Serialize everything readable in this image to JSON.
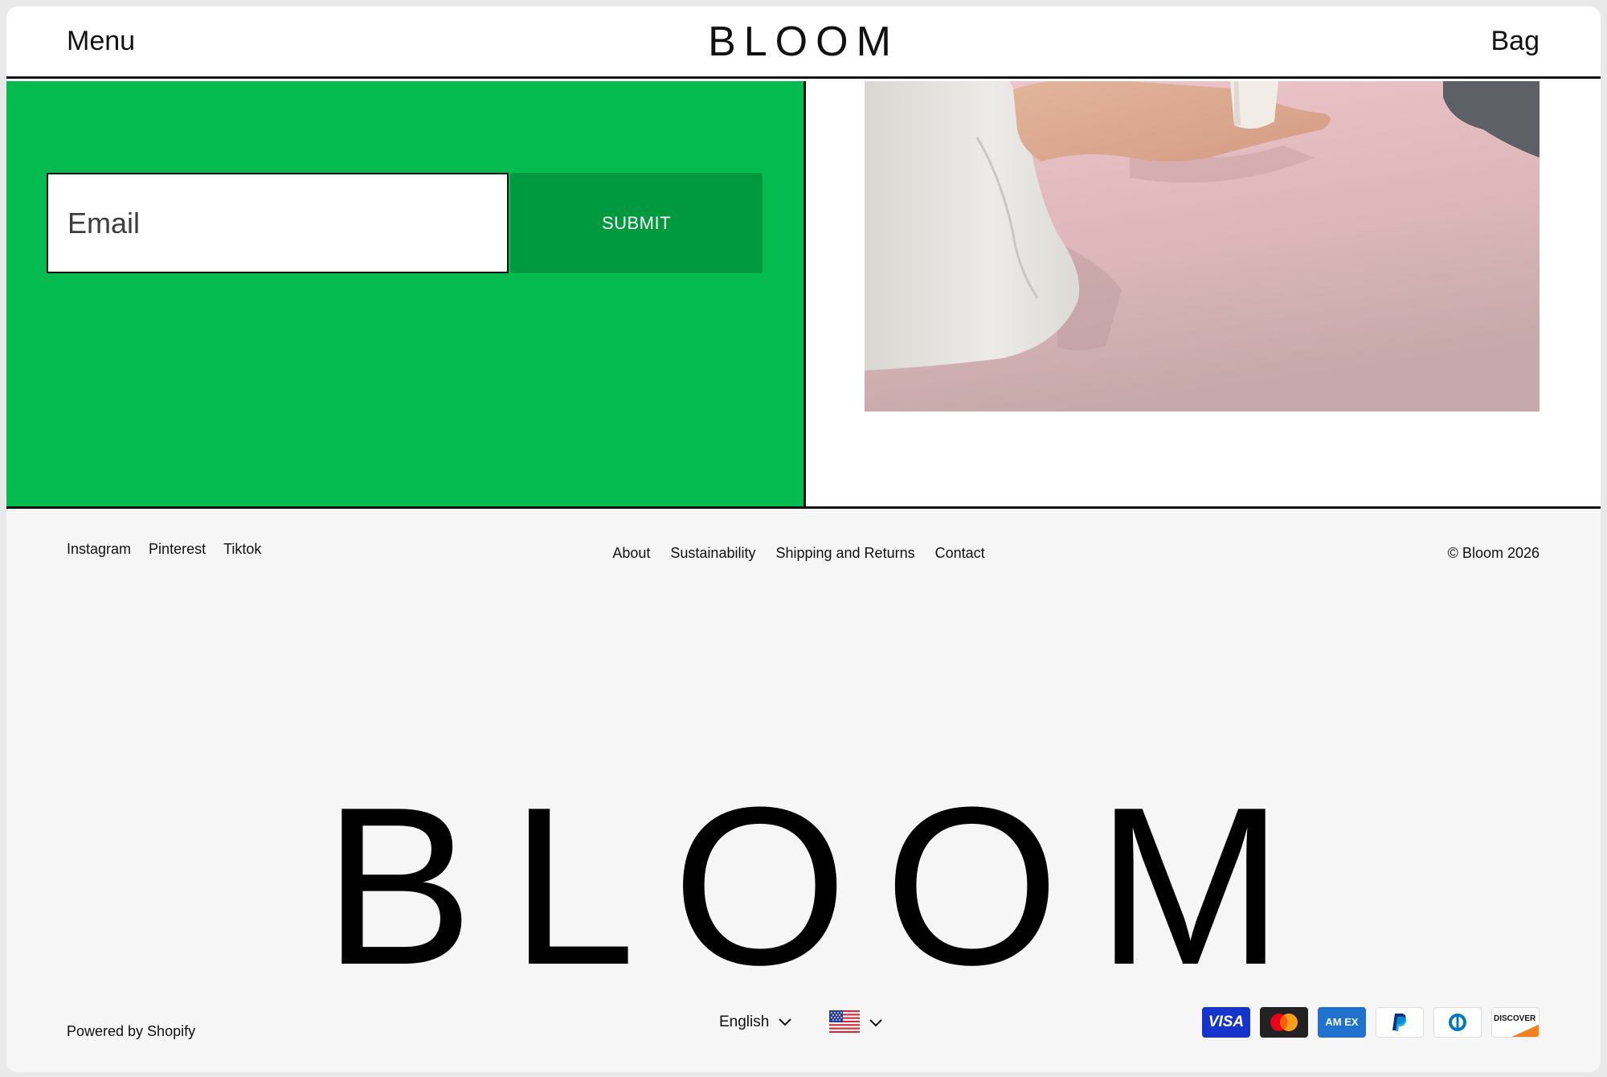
{
  "header": {
    "menu_label": "Menu",
    "logo": "BLOOM",
    "bag_label": "Bag"
  },
  "signup": {
    "email_placeholder": "Email",
    "submit_label": "SUBMIT",
    "panel_color": "#03bb4f",
    "button_color": "#009a3e"
  },
  "footer": {
    "social": [
      "Instagram",
      "Pinterest",
      "Tiktok"
    ],
    "nav": [
      "About",
      "Sustainability",
      "Shipping and Returns",
      "Contact"
    ],
    "copyright": "© Bloom 2026",
    "big_logo": "BLOOM",
    "powered_by": "Powered by Shopify",
    "language": "English",
    "country_flag": "us-flag-icon",
    "payments": {
      "visa": "VISA",
      "amex": "AM EX",
      "discover": "DISCOVER",
      "icons": [
        "visa-icon",
        "mastercard-icon",
        "amex-icon",
        "paypal-icon",
        "diners-club-icon",
        "discover-icon"
      ]
    }
  }
}
